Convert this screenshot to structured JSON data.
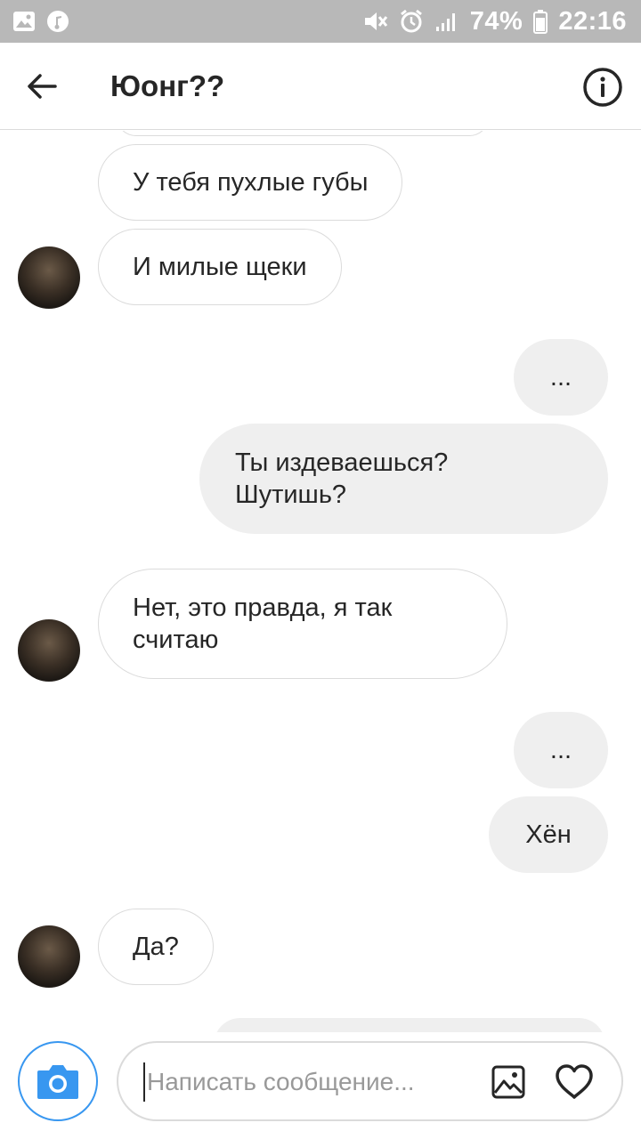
{
  "status_bar": {
    "battery": "74%",
    "time": "22:16",
    "icons": [
      "image-icon",
      "music-icon",
      "mute-icon",
      "alarm-icon",
      "signal-icon",
      "battery-icon"
    ]
  },
  "header": {
    "title": "Юонг??",
    "back_icon": "arrow-left-icon",
    "info_icon": "info-icon"
  },
  "messages": [
    {
      "from": "them",
      "text": "У тебя пухлые губы"
    },
    {
      "from": "them",
      "text": "И милые щеки",
      "avatar": true
    },
    {
      "from": "me",
      "text": "..."
    },
    {
      "from": "me",
      "text": "Ты издеваешься?\nШутишь?"
    },
    {
      "from": "them",
      "text": "Нет, это правда, я так считаю",
      "avatar": true
    },
    {
      "from": "me",
      "text": "..."
    },
    {
      "from": "me",
      "text": "Хён"
    },
    {
      "from": "them",
      "text": "Да?",
      "avatar": true
    }
  ],
  "composer": {
    "placeholder": "Написать сообщение...",
    "camera_icon": "camera-icon",
    "gallery_icon": "gallery-icon",
    "heart_icon": "heart-icon"
  },
  "colors": {
    "status_bar": "#b8b8b8",
    "incoming_bubble_border": "#dbdbdb",
    "outgoing_bubble": "#efefef",
    "camera_accent": "#3897f0",
    "text": "#262626"
  }
}
